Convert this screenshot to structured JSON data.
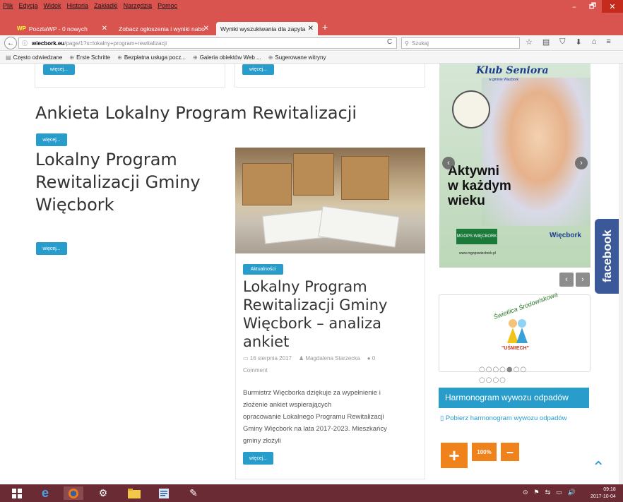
{
  "menu": [
    "Plik",
    "Edycja",
    "Widok",
    "Historia",
    "Zakładki",
    "Narzędzia",
    "Pomoc"
  ],
  "window_controls": {
    "minimize": "–",
    "maximize": "🗗",
    "close": "✕"
  },
  "tabs": [
    {
      "label": "PocztaWP - 0 nowych",
      "icon": "WP",
      "close": "✕"
    },
    {
      "label": "Zobacz ogłoszenia i wyniki nabo",
      "close": "✕"
    },
    {
      "label": "Wyniki wyszukiwania dla zapyta",
      "close": "✕"
    }
  ],
  "new_tab": "+",
  "nav": {
    "back": "←",
    "url_host": "wiecbork.eu",
    "url_path": "/page/1?s=lokalny+program+rewitalizacji",
    "reload": "C",
    "search_placeholder": "Szukaj",
    "icons": [
      "☆",
      "▤",
      "⛉",
      "⬇",
      "⌂",
      "≡"
    ]
  },
  "bookmarks": [
    "Często odwiedzane",
    "Erste Schritte",
    "Bezpłatna usługa pocz...",
    "Galeria obiektów Web ...",
    "Sugerowane witryny"
  ],
  "content": {
    "top_more_1": "więcej...",
    "top_more_2": "więcej...",
    "heading_1": "Ankieta Lokalny Program Rewitalizacji",
    "more_1": "więcej...",
    "heading_2_lines": [
      "Lokalny Program",
      "Rewitalizacji Gminy",
      "Więcbork"
    ],
    "more_2": "więcej...",
    "article": {
      "category": "Aktualności",
      "title_lines": [
        "Lokalny Program",
        "Rewitalizacji Gminy",
        "Więcbork – analiza",
        "ankiet"
      ],
      "date": "16 sierpnia 2017",
      "author": "Magdalena Starzecka",
      "comments": "0",
      "comment_label": "Comment",
      "excerpt_lines": [
        "Burmistrz Więcborka dziękuje za wypełnienie i",
        "złożenie ankiet wspierających",
        "opracowanie Lokalnego Programu Rewitalizacji",
        "Gminy Więcbork na lata 2017-2023. Mieszkańcy",
        "gminy złożyli"
      ],
      "more": "więcej..."
    }
  },
  "sidebar": {
    "banner": {
      "title": "Klub Seniora",
      "subtitle": "w gminie Więcbork",
      "slogan_lines": [
        "Aktywni",
        "w każdym",
        "wieku"
      ],
      "mgops": "MGOPS WIĘCBORK",
      "logo_text": "Więcbork",
      "site": "www.mgopswiecbork.pl",
      "prev": "‹",
      "next": "›"
    },
    "slider_prev": "‹",
    "slider_next": "›",
    "smile": {
      "arc": "Świetlica Środowiskowa",
      "label": "\"UŚMIECH\""
    },
    "dots_row1": "○○○○●○○",
    "dots_row2": "○○○○",
    "harmonogram_title": "Harmonogram wywozu odpadów",
    "harmonogram_link": "Pobierz harmonogram wywozu odpadów",
    "zoom": {
      "plus": "+",
      "reset": "100%",
      "minus": "–"
    }
  },
  "facebook": "facebook",
  "to_top": "⌃",
  "taskbar": {
    "tray": [
      "⊙",
      "⚑",
      "⇆",
      "▭",
      "🔊"
    ],
    "time": "09:18",
    "date": "2017-10-04"
  }
}
